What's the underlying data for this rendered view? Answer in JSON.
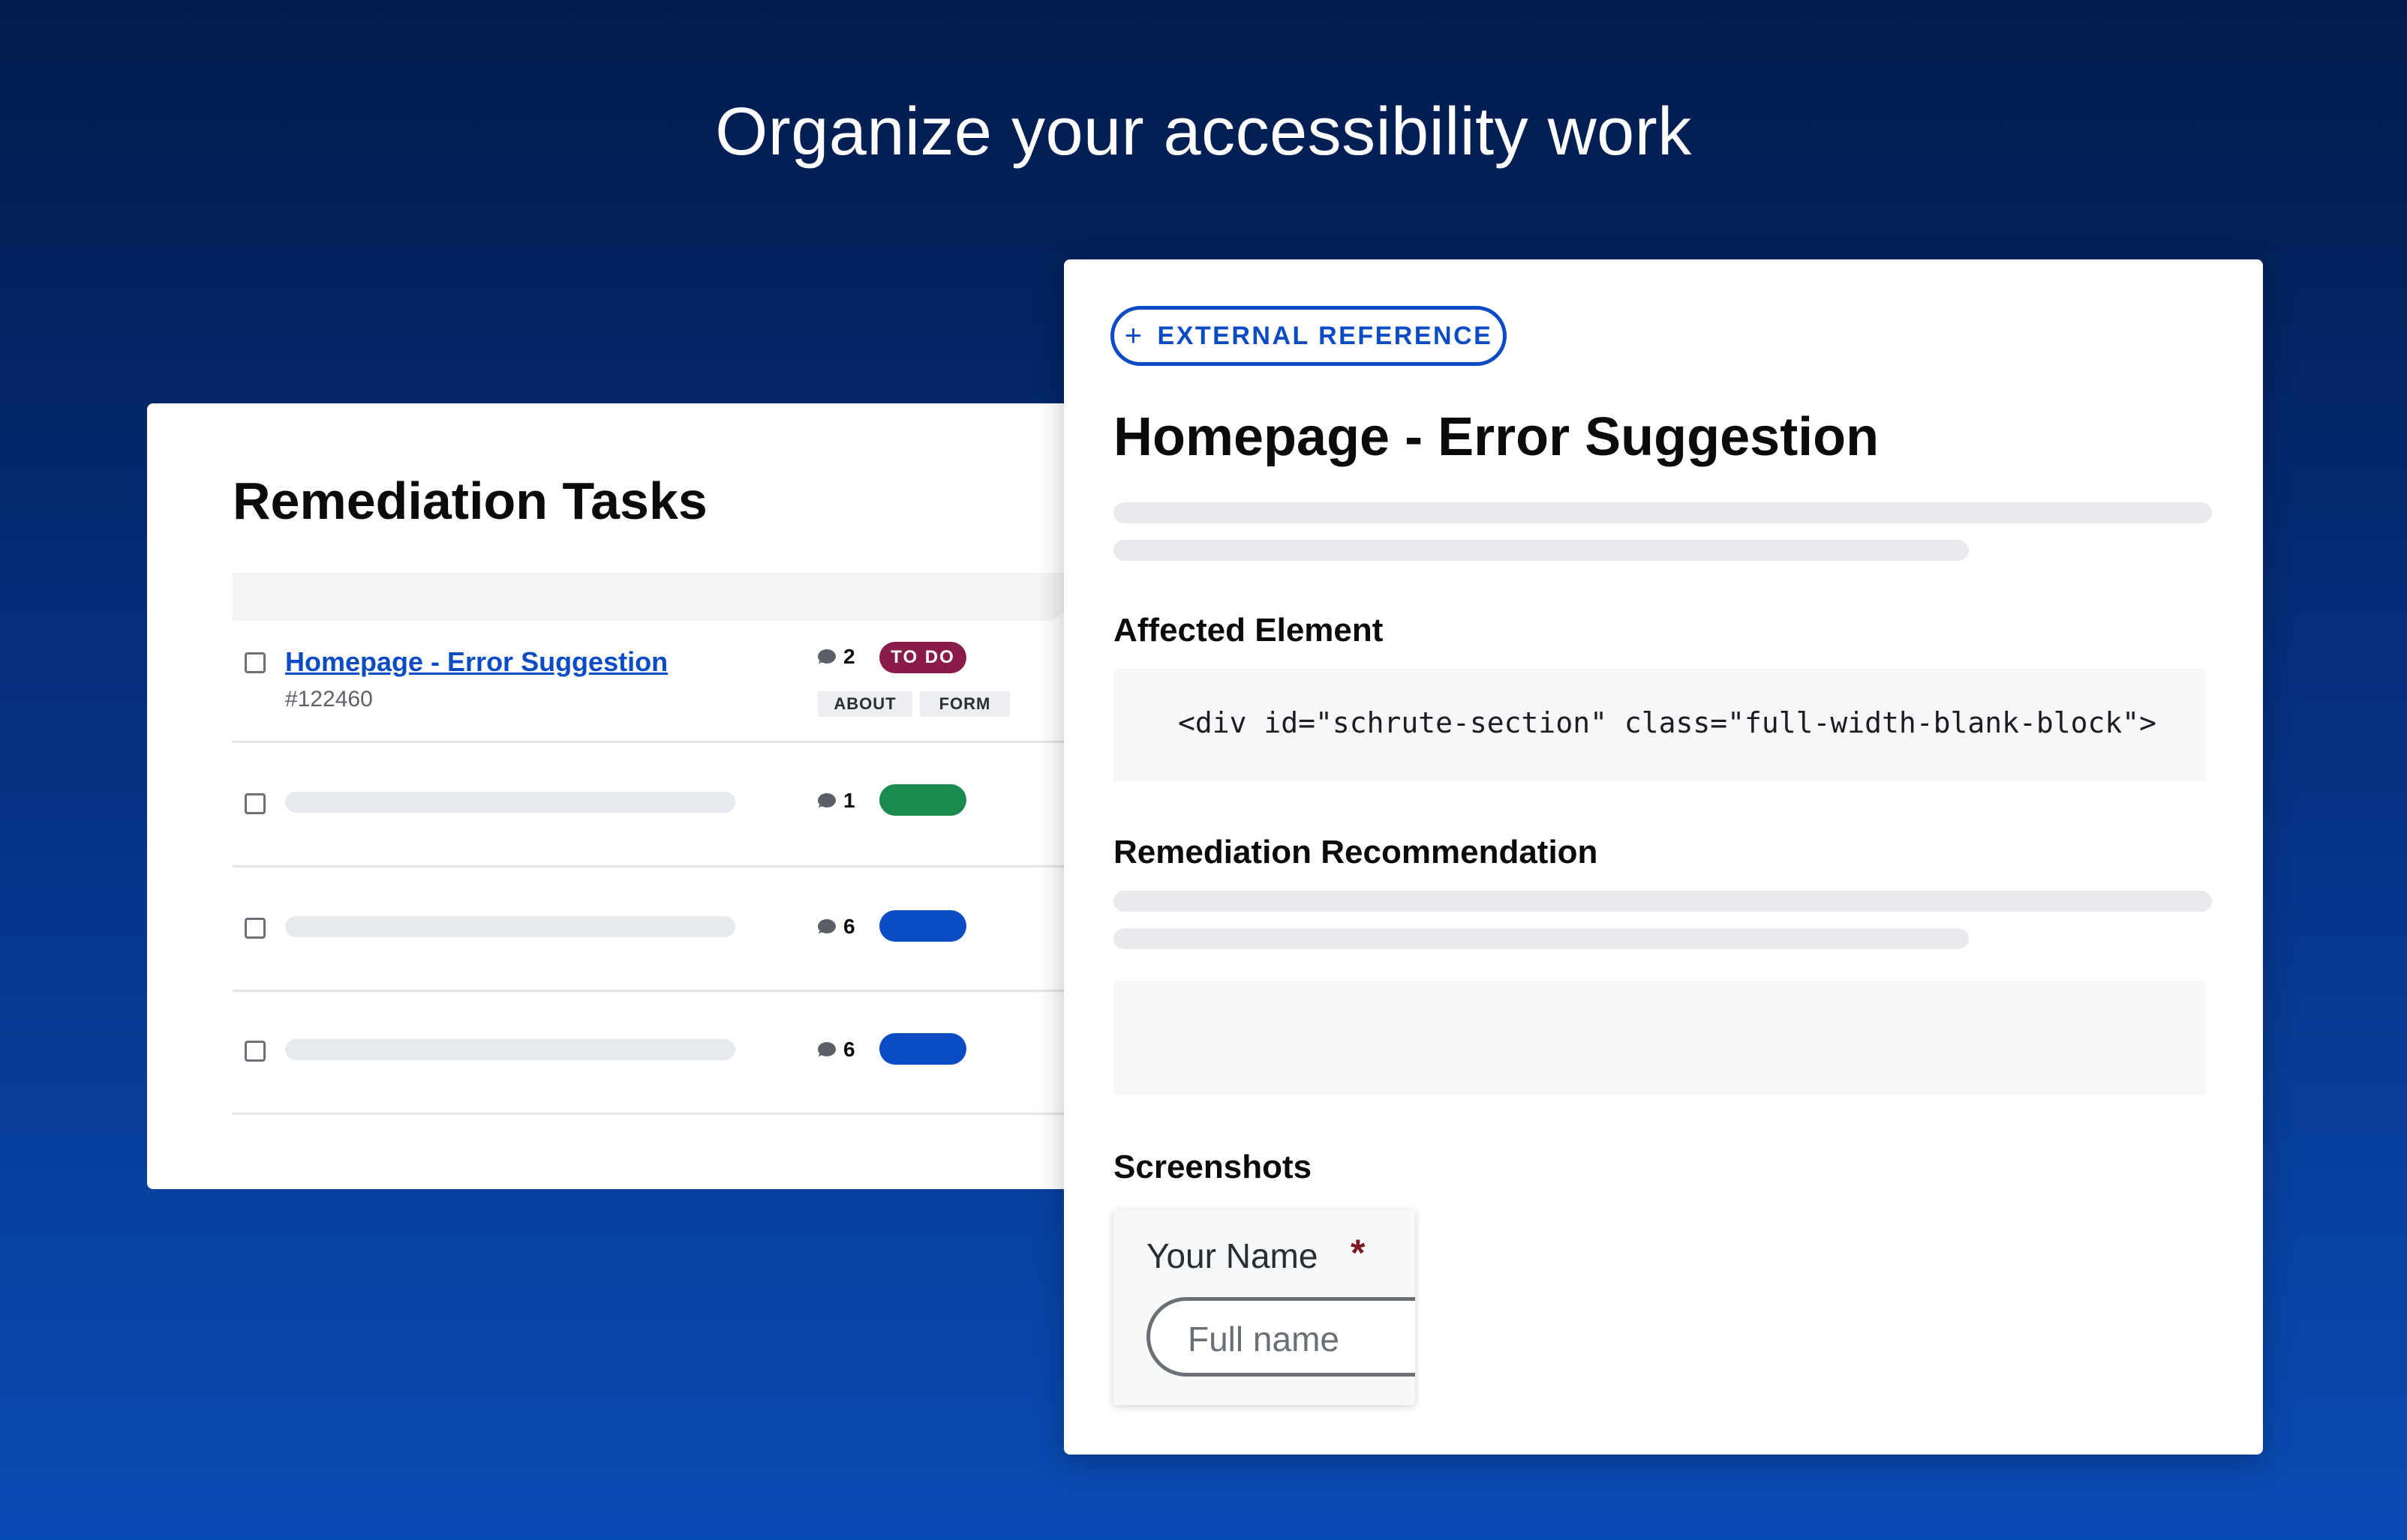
{
  "headline": "Organize your accessibility work",
  "tasks": {
    "title": "Remediation Tasks",
    "rows": [
      {
        "title": "Homepage - Error Suggestion",
        "id": "#122460",
        "comments": "2",
        "status": "TO DO",
        "status_color": "#8a1c4a",
        "tags": [
          "ABOUT",
          "FORM"
        ]
      },
      {
        "comments": "1",
        "status_color": "#1a8a4f"
      },
      {
        "comments": "6",
        "status_color": "#0b4cc4"
      },
      {
        "comments": "6",
        "status_color": "#0b4cc4"
      }
    ]
  },
  "detail": {
    "external_reference_label": "EXTERNAL REFERENCE",
    "title": "Homepage - Error Suggestion",
    "affected_element_heading": "Affected Element",
    "affected_element_code": "<div id=\"schrute-section\" class=\"full-width-blank-block\">",
    "remediation_heading": "Remediation Recommendation",
    "screenshots_heading": "Screenshots",
    "screenshot_form": {
      "label": "Your Name",
      "required_marker": "*",
      "placeholder": "Full name"
    }
  },
  "colors": {
    "accent": "#0b4cc4",
    "todo": "#8a1c4a",
    "green": "#1a8a4f"
  }
}
